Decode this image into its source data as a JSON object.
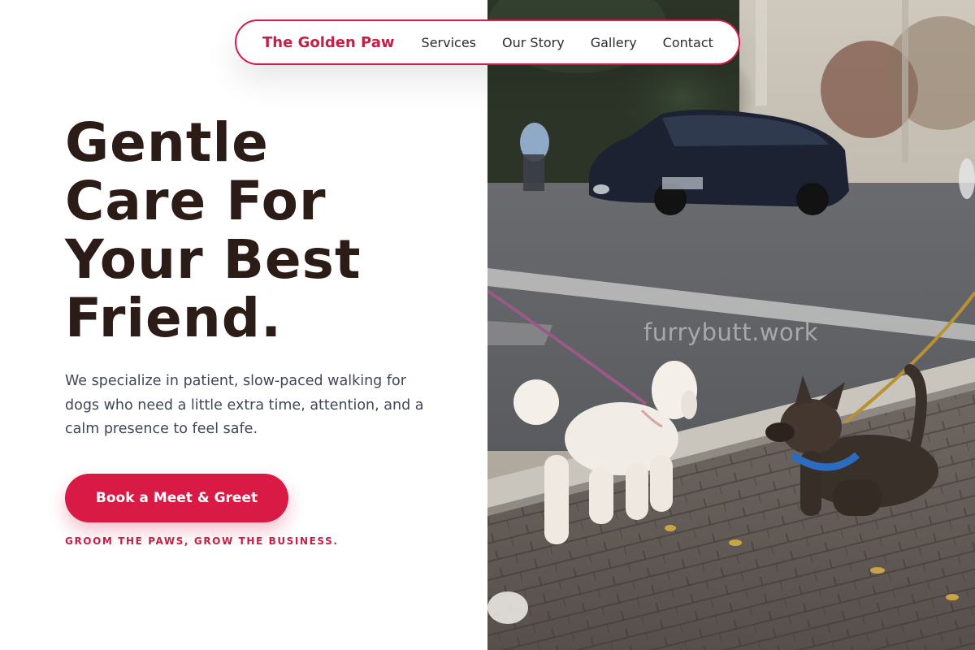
{
  "nav": {
    "brand": "The Golden Paw",
    "links": [
      "Services",
      "Our Story",
      "Gallery",
      "Contact"
    ]
  },
  "hero": {
    "headline_lines": [
      "Gentle",
      "Care For",
      "Your Best",
      "Friend."
    ],
    "description": "We specialize in patient, slow-paced walking for dogs who need a little extra time, attention, and a calm presence to feel safe.",
    "cta_label": "Book a Meet & Greet",
    "tagline": "GROOM THE PAWS, GROW THE BUSINESS."
  },
  "photo": {
    "watermark": "furrybutt.work",
    "subject": "two-dogs-on-leashes-street-photo"
  },
  "colors": {
    "accent": "#d91a45",
    "heading": "#2b1c18",
    "body_text": "#3f4656"
  }
}
